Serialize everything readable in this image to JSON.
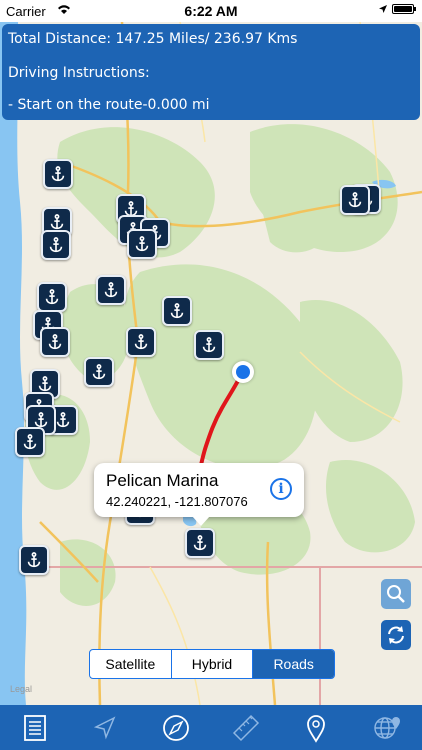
{
  "status_bar": {
    "carrier": "Carrier",
    "time": "6:22 AM"
  },
  "info_panel": {
    "total_distance": "Total Distance: 147.25 Miles/ 236.97 Kms",
    "instructions_label": "Driving Instructions:",
    "instruction_1": "- Start on the route-0.000 mi"
  },
  "callout": {
    "name": "Pelican Marina",
    "coords": "42.240221, -121.807076"
  },
  "map_types": {
    "satellite": "Satellite",
    "hybrid": "Hybrid",
    "roads": "Roads",
    "selected": "Roads"
  },
  "legal": "Legal",
  "colors": {
    "accent": "#1d64b4",
    "route": "#e0161b",
    "marker": "#0f2a4a",
    "water": "#88c5f2"
  },
  "icons": [
    "anchor-icon",
    "search-icon",
    "refresh-icon",
    "list-icon",
    "navigation-arrow-icon",
    "compass-icon",
    "ruler-icon",
    "map-pin-icon",
    "globe-icon"
  ]
}
